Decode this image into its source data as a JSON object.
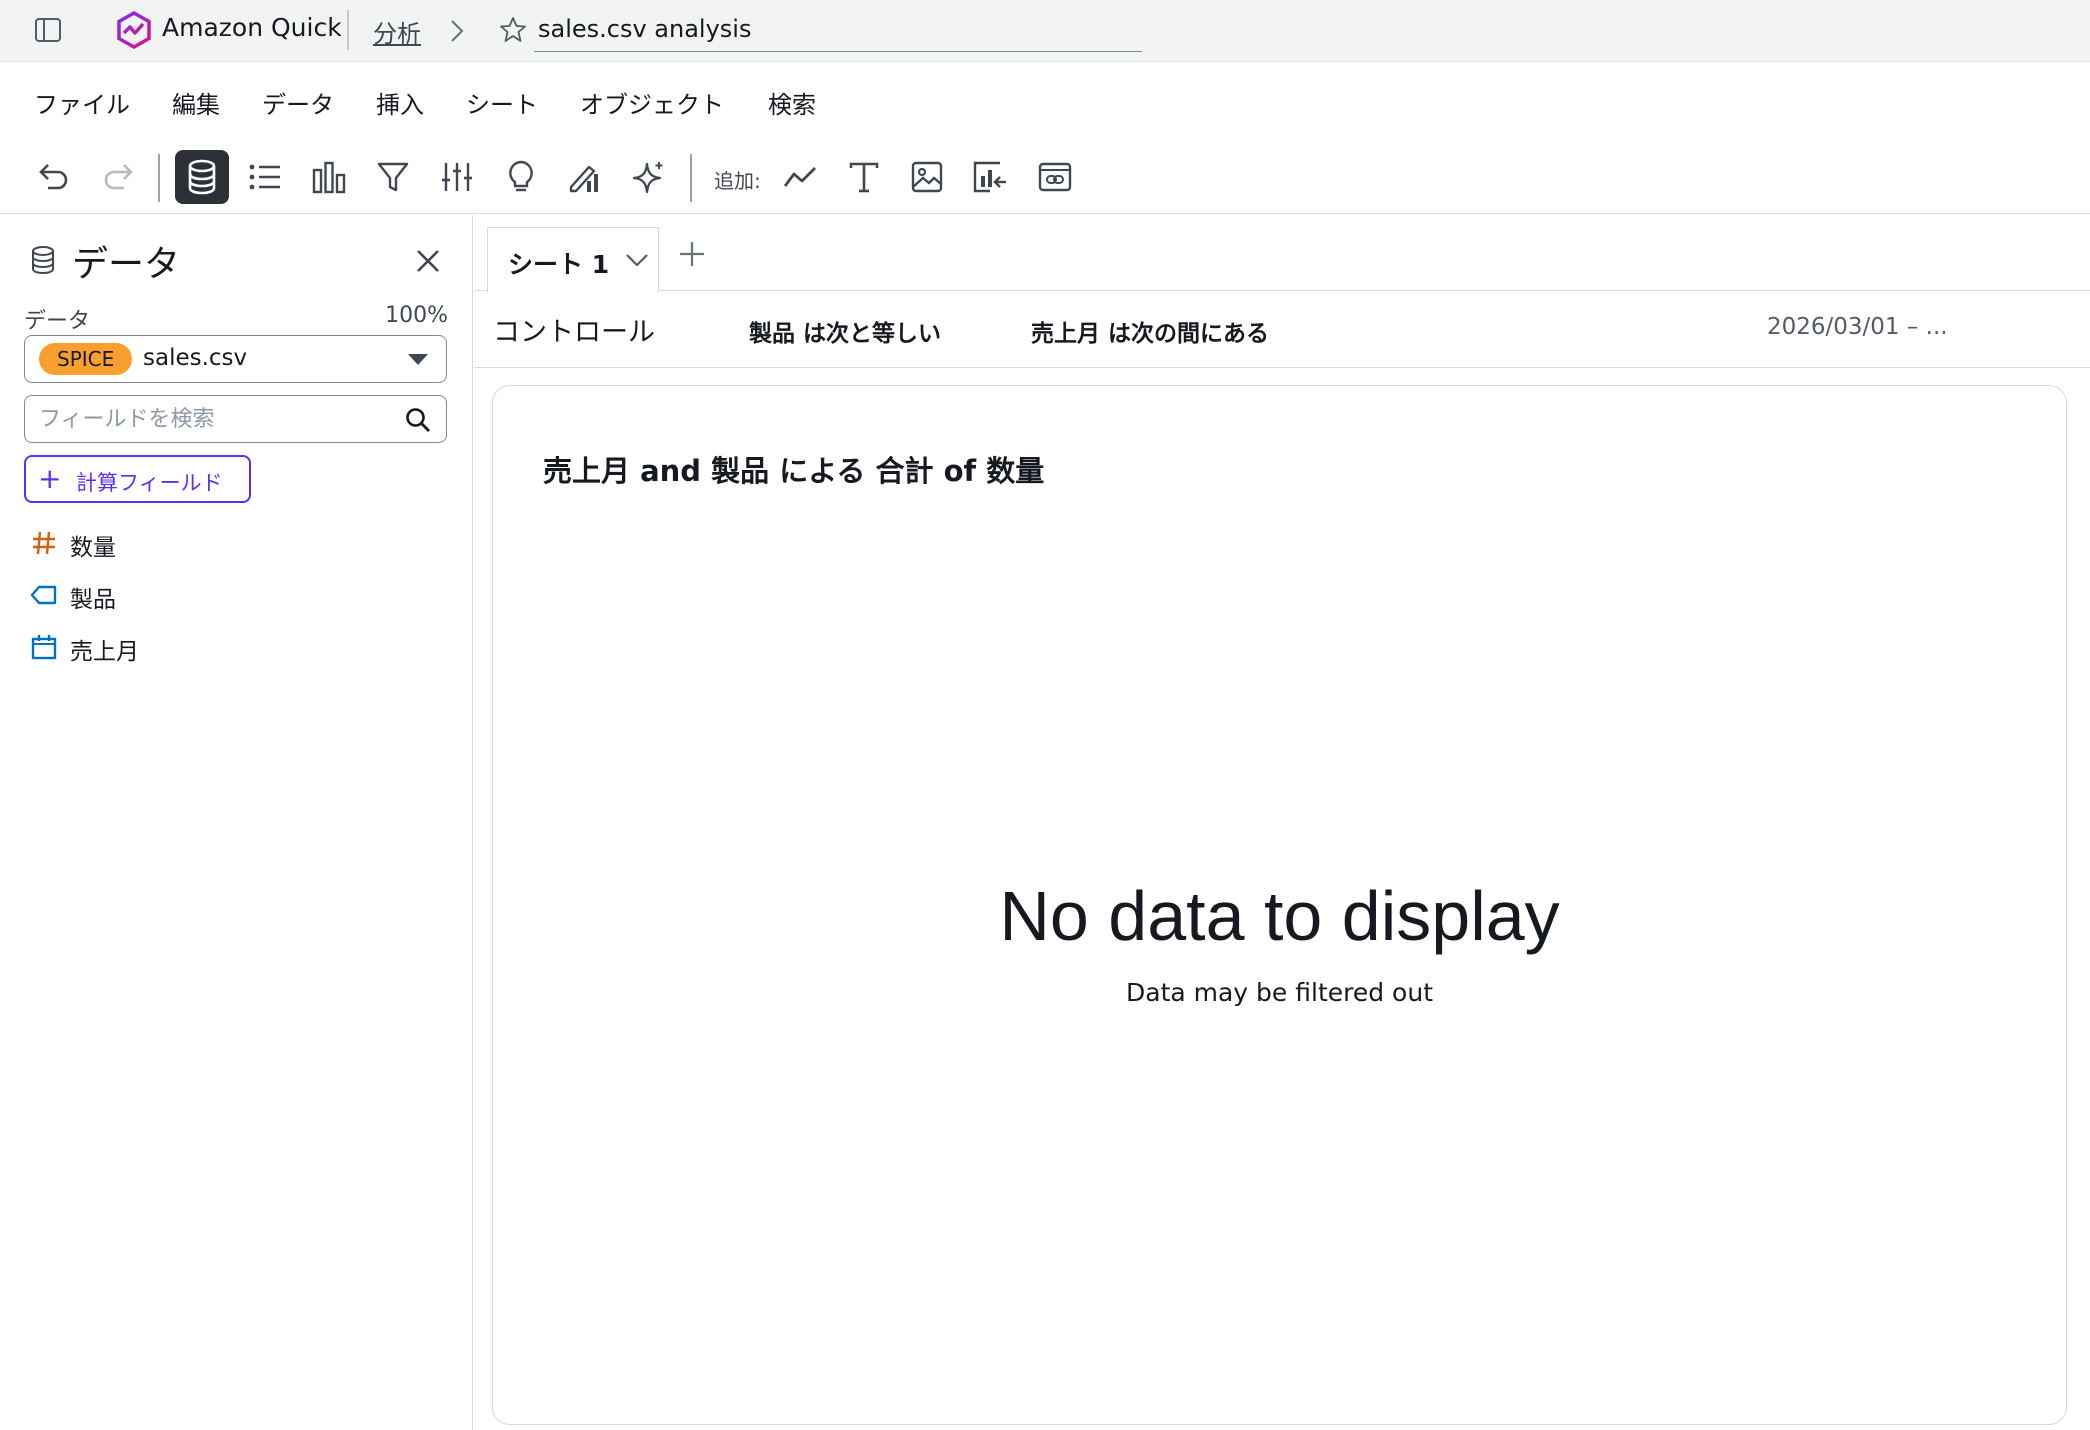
{
  "header": {
    "app_name": "Amazon Quick",
    "breadcrumb": "分析",
    "analysis_title": "sales.csv analysis"
  },
  "menu": {
    "items": [
      "ファイル",
      "編集",
      "データ",
      "挿入",
      "シート",
      "オブジェクト",
      "検索"
    ]
  },
  "toolbar": {
    "add_label": "追加:",
    "icons": [
      "undo-icon",
      "redo-icon",
      "database-icon",
      "list-icon",
      "bar-chart-icon",
      "filter-icon",
      "sliders-icon",
      "lightbulb-icon",
      "pencil-chart-icon",
      "sparkle-icon",
      "line-chart-icon",
      "text-icon",
      "image-icon",
      "insight-icon",
      "embed-icon"
    ]
  },
  "data_panel": {
    "title": "データ",
    "data_label": "データ",
    "usage_percent": "100%",
    "dataset": {
      "badge": "SPICE",
      "name": "sales.csv"
    },
    "search_placeholder": "フィールドを検索",
    "calc_field_label": "計算フィールド",
    "fields": [
      {
        "name": "数量",
        "type": "numeric",
        "icon": "hash-icon"
      },
      {
        "name": "製品",
        "type": "dimension",
        "icon": "tag-icon"
      },
      {
        "name": "売上月",
        "type": "date",
        "icon": "calendar-icon"
      }
    ]
  },
  "sheets": {
    "tabs": [
      {
        "label": "シート 1"
      }
    ]
  },
  "controls": {
    "title": "コントロール",
    "items": [
      {
        "label": "製品 は次と等しい",
        "value": ""
      },
      {
        "label": "売上月 は次の間にある",
        "value": "2026/03/01 – ..."
      }
    ]
  },
  "visual": {
    "title": "売上月 and 製品 による 合計 of 数量",
    "empty_title": "No data to display",
    "empty_subtitle": "Data may be filtered out"
  },
  "colors": {
    "accent": "#5f2ef2",
    "spice_badge": "#f89f2f",
    "numeric_field": "#d5600c",
    "dimension_field": "#0073bb",
    "active_tool_bg": "#2d3137"
  }
}
